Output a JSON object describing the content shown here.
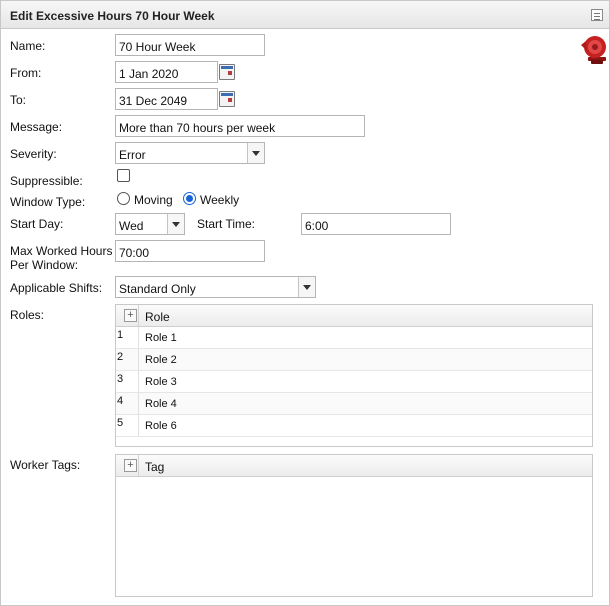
{
  "window": {
    "title": "Edit Excessive Hours 70 Hour Week"
  },
  "form": {
    "name": {
      "label": "Name:",
      "value": "70 Hour Week"
    },
    "from": {
      "label": "From:",
      "value": "1 Jan 2020"
    },
    "to": {
      "label": "To:",
      "value": "31 Dec 2049"
    },
    "message": {
      "label": "Message:",
      "value": "More than 70 hours per week"
    },
    "severity": {
      "label": "Severity:",
      "value": "Error"
    },
    "suppressible": {
      "label": "Suppressible:",
      "checked": false
    },
    "window_type": {
      "label": "Window Type:",
      "options": [
        "Moving",
        "Weekly"
      ],
      "selected": "Weekly"
    },
    "start_day": {
      "label": "Start Day:",
      "value": "Wed"
    },
    "start_time": {
      "label": "Start Time:",
      "value": "6:00"
    },
    "max_worked_hours": {
      "label_line1": "Max Worked Hours",
      "label_line2": "Per Window:",
      "value": "70:00"
    },
    "applicable_shifts": {
      "label": "Applicable Shifts:",
      "value": "Standard Only"
    },
    "roles": {
      "label": "Roles:",
      "column_header": "Role",
      "add_symbol": "+",
      "rows": [
        {
          "num": "1",
          "role": "Role 1"
        },
        {
          "num": "2",
          "role": "Role 2"
        },
        {
          "num": "3",
          "role": "Role 3"
        },
        {
          "num": "4",
          "role": "Role 4"
        },
        {
          "num": "5",
          "role": "Role 6"
        }
      ]
    },
    "worker_tags": {
      "label": "Worker Tags:",
      "column_header": "Tag",
      "add_symbol": "+"
    }
  },
  "icons": {
    "alarm": "alarm-bell-icon",
    "calendar": "calendar-icon",
    "dropdown": "chevron-down-icon",
    "menu": "panel-menu-icon"
  },
  "colors": {
    "alarm_red": "#c62020",
    "radio_blue": "#1a64d8"
  }
}
